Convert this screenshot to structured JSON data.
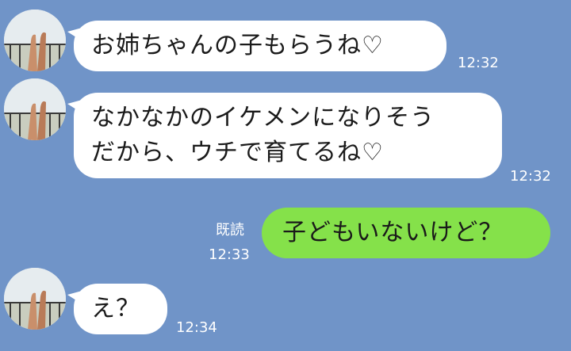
{
  "messages": [
    {
      "sender": "other",
      "text": "お姉ちゃんの子もらうね♡",
      "time": "12:32"
    },
    {
      "sender": "other",
      "line1": "なかなかのイケメンになりそう",
      "line2": "だから、ウチで育てるね♡",
      "time": "12:32"
    },
    {
      "sender": "me",
      "text": "子どもいないけど？",
      "read": "既読",
      "time": "12:33"
    },
    {
      "sender": "other",
      "text": "え？",
      "time": "12:34"
    }
  ],
  "colors": {
    "background": "#7094c8",
    "incoming_bubble": "#ffffff",
    "outgoing_bubble": "#85e14a",
    "timestamp": "#ffffff"
  },
  "icons": {
    "avatar": "avatar-photo-feet-on-balcony"
  }
}
